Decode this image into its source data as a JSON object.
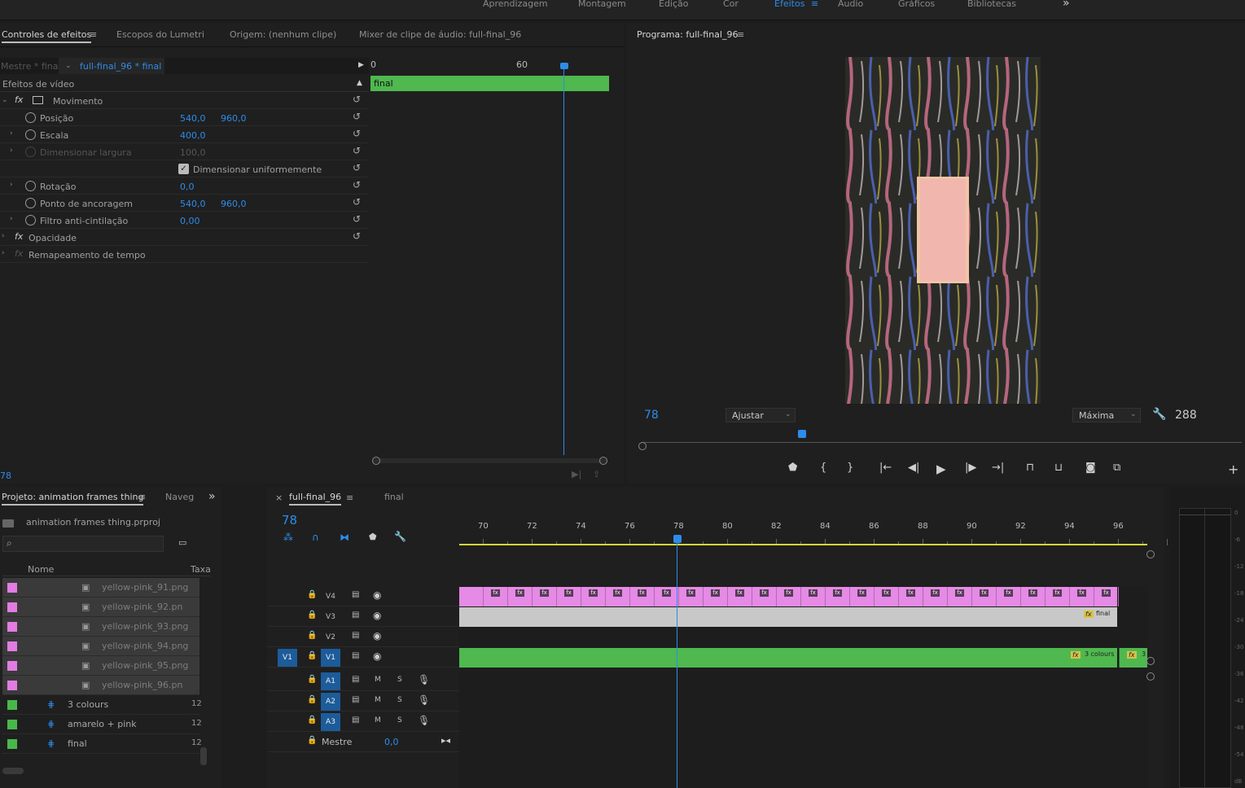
{
  "workspaces": [
    {
      "label": "Aprendizagem",
      "active": false
    },
    {
      "label": "Montagem",
      "active": false
    },
    {
      "label": "Edição",
      "active": false
    },
    {
      "label": "Cor",
      "active": false
    },
    {
      "label": "Efeitos",
      "active": true
    },
    {
      "label": "Áudio",
      "active": false
    },
    {
      "label": "Gráficos",
      "active": false
    },
    {
      "label": "Bibliotecas",
      "active": false
    }
  ],
  "more_glyph": "»",
  "effect_panel": {
    "tabs": [
      "Controles de efeitos",
      "Escopos do Lumetri",
      "Origem: (nenhum clipe)",
      "Mixer de clipe de áudio: full-final_96"
    ],
    "master": "Mestre * final",
    "clip": "full-final_96 * final",
    "section": "Efeitos de vídeo",
    "mini_ruler": [
      "0",
      "60"
    ],
    "mini_clip": "final",
    "current_time": "78",
    "rows": [
      {
        "fx": "fx",
        "label": "Movimento",
        "v1": "",
        "v2": ""
      },
      {
        "label": "Posição",
        "v1": "540,0",
        "v2": "960,0"
      },
      {
        "label": "Escala",
        "v1": "400,0",
        "v2": ""
      },
      {
        "label": "Dimensionar largura",
        "v1": "100,0",
        "v2": ""
      },
      {
        "label": "Dimensionar uniformemente",
        "v1": "",
        "v2": ""
      },
      {
        "label": "Rotação",
        "v1": "0,0",
        "v2": ""
      },
      {
        "label": "Ponto de ancoragem",
        "v1": "540,0",
        "v2": "960,0"
      },
      {
        "label": "Filtro anti-cintilação",
        "v1": "0,00",
        "v2": ""
      },
      {
        "fx": "fx",
        "label": "Opacidade",
        "v1": "",
        "v2": ""
      },
      {
        "fx": "fx",
        "label": "Remapeamento de tempo",
        "v1": "",
        "v2": ""
      }
    ]
  },
  "program": {
    "title": "Programa: full-final_96",
    "timecode": "78",
    "fit": "Ajustar",
    "quality": "Máxima",
    "duration": "288",
    "colors": {
      "bg": "#2a2b27",
      "overlay": "#f2c4a6"
    }
  },
  "project": {
    "title": "Projeto: animation frames thing",
    "tab2": "Naveg",
    "file": "animation frames thing.prproj",
    "col_name": "Nome",
    "col_rate": "Taxa",
    "items": [
      {
        "name": "yellow-pink_91.png",
        "rate": "",
        "color": "#e27ce2",
        "sel": true,
        "kind": "img"
      },
      {
        "name": "yellow-pink_92.pn",
        "rate": "",
        "color": "#e27ce2",
        "sel": true,
        "kind": "img"
      },
      {
        "name": "yellow-pink_93.png",
        "rate": "",
        "color": "#e27ce2",
        "sel": true,
        "kind": "img"
      },
      {
        "name": "yellow-pink_94.png",
        "rate": "",
        "color": "#e27ce2",
        "sel": true,
        "kind": "img"
      },
      {
        "name": "yellow-pink_95.png",
        "rate": "",
        "color": "#e27ce2",
        "sel": true,
        "kind": "img"
      },
      {
        "name": "yellow-pink_96.pn",
        "rate": "",
        "color": "#e27ce2",
        "sel": true,
        "kind": "img"
      },
      {
        "name": "3 colours",
        "rate": "12",
        "color": "#48b84a",
        "sel": false,
        "kind": "seq"
      },
      {
        "name": "amarelo + pink",
        "rate": "12",
        "color": "#48b84a",
        "sel": false,
        "kind": "seq"
      },
      {
        "name": "final",
        "rate": "12",
        "color": "#48b84a",
        "sel": false,
        "kind": "seq"
      }
    ]
  },
  "timeline": {
    "tabs": [
      "full-final_96",
      "final"
    ],
    "close": "×",
    "timecode": "78",
    "ruler": [
      "70",
      "72",
      "74",
      "76",
      "78",
      "80",
      "82",
      "84",
      "86",
      "88",
      "90",
      "92",
      "94",
      "96"
    ],
    "video_tracks": [
      "V4",
      "V3",
      "V2",
      "V1"
    ],
    "source_patch": "V1",
    "audio_tracks": [
      "A1",
      "A2",
      "A3"
    ],
    "mute": "M",
    "solo": "S",
    "master": "Mestre",
    "master_val": "0,0",
    "clip_v3": "final",
    "clip_v1": "3 colours",
    "clip_v1b": "3",
    "fx": "fx",
    "colors": {
      "pink": "#e58ae5",
      "green": "#4fb84f",
      "gray": "#c8c8c8",
      "playhead": "#2d8ceb"
    }
  },
  "meter_ticks": [
    "0",
    "-6",
    "-12",
    "-18",
    "-24",
    "-30",
    "-36",
    "-42",
    "-48",
    "-54",
    "dB"
  ]
}
